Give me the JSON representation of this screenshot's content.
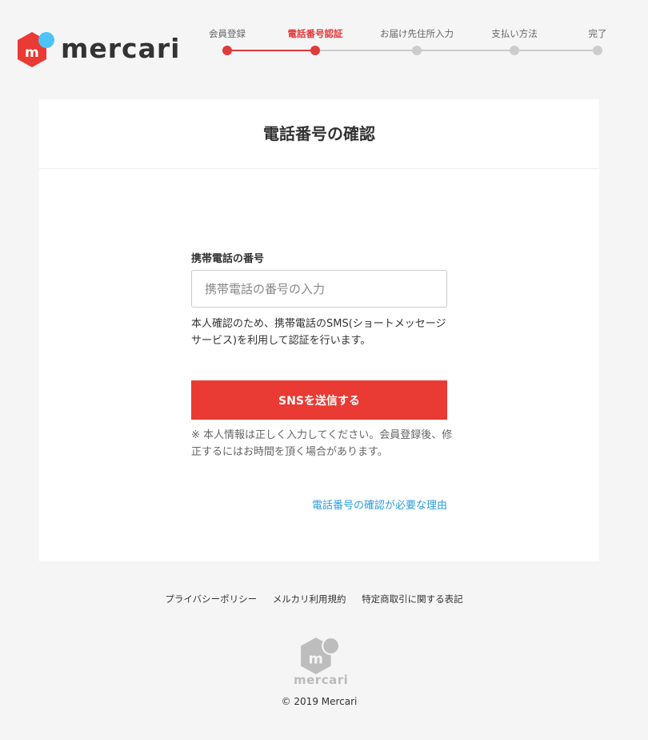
{
  "brand": {
    "name": "mercari",
    "accent_color": "#e93a33",
    "dot_color": "#4dc3f7"
  },
  "stepper": {
    "steps": [
      {
        "label": "会員登録",
        "state": "done"
      },
      {
        "label": "電話番号認証",
        "state": "current"
      },
      {
        "label": "お届け先住所入力",
        "state": "todo"
      },
      {
        "label": "支払い方法",
        "state": "todo"
      },
      {
        "label": "完了",
        "state": "todo"
      }
    ]
  },
  "card": {
    "title": "電話番号の確認",
    "field_label": "携帯電話の番号",
    "phone_value": "",
    "phone_placeholder": "携帯電話の番号の入力",
    "help_text": "本人確認のため、携帯電話のSMS(ショートメッセージサービス)を利用して認証を行います。",
    "submit_label": "SNSを送信する",
    "note_text": "※ 本人情報は正しく入力してください。会員登録後、修正するにはお時間を頂く場合があります。",
    "reason_link": "電話番号の確認が必要な理由"
  },
  "footer": {
    "links": [
      "プライバシーポリシー",
      "メルカリ利用規約",
      "特定商取引に関する表記"
    ],
    "logo_text": "mercari",
    "copyright": "© 2019 Mercari"
  }
}
